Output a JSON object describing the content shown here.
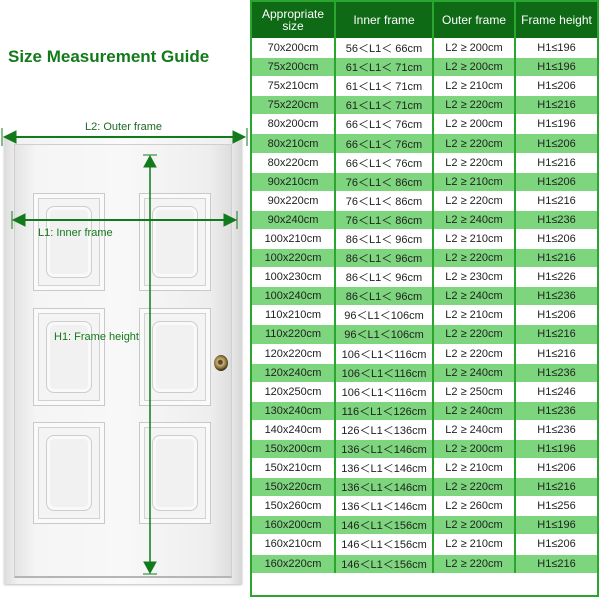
{
  "title": "Size Measurement Guide",
  "diagram": {
    "outer_label": "L2: Outer frame",
    "inner_label": "L1: Inner frame",
    "height_label": "H1: Frame height",
    "accent_color": "#137a1b",
    "icons": [
      "arrow-left-icon",
      "arrow-right-icon",
      "arrow-up-icon",
      "arrow-down-icon",
      "door-knob-icon"
    ]
  },
  "table": {
    "headers": [
      "Appropriate size",
      "Inner frame",
      "Outer frame",
      "Frame height"
    ],
    "header_color": "#0f6a15",
    "stripe_color": "#7dd57e",
    "rows": [
      [
        "70x200cm",
        "56＜L1＜ 66cm",
        "L2 ≥ 200cm",
        "H1≤196"
      ],
      [
        "75x200cm",
        "61＜L1＜ 71cm",
        "L2 ≥ 200cm",
        "H1≤196"
      ],
      [
        "75x210cm",
        "61＜L1＜ 71cm",
        "L2 ≥ 210cm",
        "H1≤206"
      ],
      [
        "75x220cm",
        "61＜L1＜ 71cm",
        "L2 ≥ 220cm",
        "H1≤216"
      ],
      [
        "80x200cm",
        "66＜L1＜ 76cm",
        "L2 ≥ 200cm",
        "H1≤196"
      ],
      [
        "80x210cm",
        "66＜L1＜ 76cm",
        "L2 ≥ 220cm",
        "H1≤206"
      ],
      [
        "80x220cm",
        "66＜L1＜ 76cm",
        "L2 ≥ 220cm",
        "H1≤216"
      ],
      [
        "90x210cm",
        "76＜L1＜ 86cm",
        "L2 ≥ 210cm",
        "H1≤206"
      ],
      [
        "90x220cm",
        "76＜L1＜ 86cm",
        "L2 ≥ 220cm",
        "H1≤216"
      ],
      [
        "90x240cm",
        "76＜L1＜ 86cm",
        "L2 ≥ 240cm",
        "H1≤236"
      ],
      [
        "100x210cm",
        "86＜L1＜ 96cm",
        "L2 ≥ 210cm",
        "H1≤206"
      ],
      [
        "100x220cm",
        "86＜L1＜ 96cm",
        "L2 ≥ 220cm",
        "H1≤216"
      ],
      [
        "100x230cm",
        "86＜L1＜ 96cm",
        "L2 ≥ 230cm",
        "H1≤226"
      ],
      [
        "100x240cm",
        "86＜L1＜ 96cm",
        "L2 ≥ 240cm",
        "H1≤236"
      ],
      [
        "110x210cm",
        "96＜L1＜106cm",
        "L2 ≥ 210cm",
        "H1≤206"
      ],
      [
        "110x220cm",
        "96＜L1＜106cm",
        "L2 ≥ 220cm",
        "H1≤216"
      ],
      [
        "120x220cm",
        "106＜L1＜116cm",
        "L2 ≥ 220cm",
        "H1≤216"
      ],
      [
        "120x240cm",
        "106＜L1＜116cm",
        "L2 ≥ 240cm",
        "H1≤236"
      ],
      [
        "120x250cm",
        "106＜L1＜116cm",
        "L2 ≥ 250cm",
        "H1≤246"
      ],
      [
        "130x240cm",
        "116＜L1＜126cm",
        "L2 ≥ 240cm",
        "H1≤236"
      ],
      [
        "140x240cm",
        "126＜L1＜136cm",
        "L2 ≥ 240cm",
        "H1≤236"
      ],
      [
        "150x200cm",
        "136＜L1＜146cm",
        "L2 ≥ 200cm",
        "H1≤196"
      ],
      [
        "150x210cm",
        "136＜L1＜146cm",
        "L2 ≥ 210cm",
        "H1≤206"
      ],
      [
        "150x220cm",
        "136＜L1＜146cm",
        "L2 ≥ 220cm",
        "H1≤216"
      ],
      [
        "150x260cm",
        "136＜L1＜146cm",
        "L2 ≥ 260cm",
        "H1≤256"
      ],
      [
        "160x200cm",
        "146＜L1＜156cm",
        "L2 ≥ 200cm",
        "H1≤196"
      ],
      [
        "160x210cm",
        "146＜L1＜156cm",
        "L2 ≥ 210cm",
        "H1≤206"
      ],
      [
        "160x220cm",
        "146＜L1＜156cm",
        "L2 ≥ 220cm",
        "H1≤216"
      ]
    ]
  }
}
